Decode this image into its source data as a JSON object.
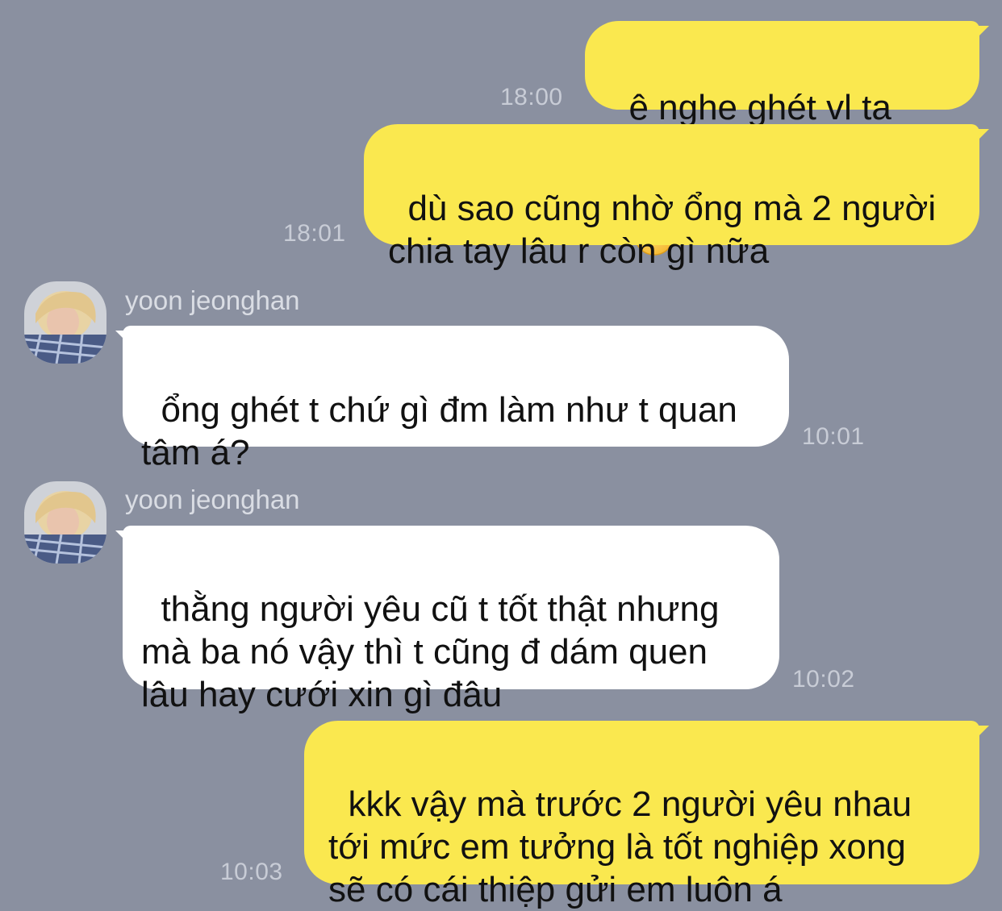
{
  "contact": {
    "name": "yoon jeonghan"
  },
  "colors": {
    "background": "#8a90a0",
    "outgoing_bubble": "#fae84f",
    "incoming_bubble": "#ffffff",
    "timestamp": "#c8ccd6"
  },
  "messages": [
    {
      "direction": "outgoing",
      "text": "ê nghe ghét vl ta",
      "emoji": "slightly-smiling-face-icon",
      "time": "18:00"
    },
    {
      "direction": "outgoing",
      "text": "dù sao cũng nhờ ổng mà 2 người\nchia tay lâu r còn gì nữa",
      "time": "18:01"
    },
    {
      "direction": "incoming",
      "sender": "yoon jeonghan",
      "text": "ổng ghét t chứ gì đm làm như t quan\ntâm á?",
      "time": "10:01"
    },
    {
      "direction": "incoming",
      "sender": "yoon jeonghan",
      "text": "thằng người yêu cũ t tốt thật nhưng\nmà ba nó vậy thì t cũng đ dám quen\nlâu hay cưới xin gì đâu",
      "time": "10:02"
    },
    {
      "direction": "outgoing",
      "text": "kkk vậy mà trước 2 người yêu nhau\ntới mức em tưởng là tốt nghiệp xong\nsẽ có cái thiệp gửi em luôn á",
      "time": "10:03"
    }
  ]
}
